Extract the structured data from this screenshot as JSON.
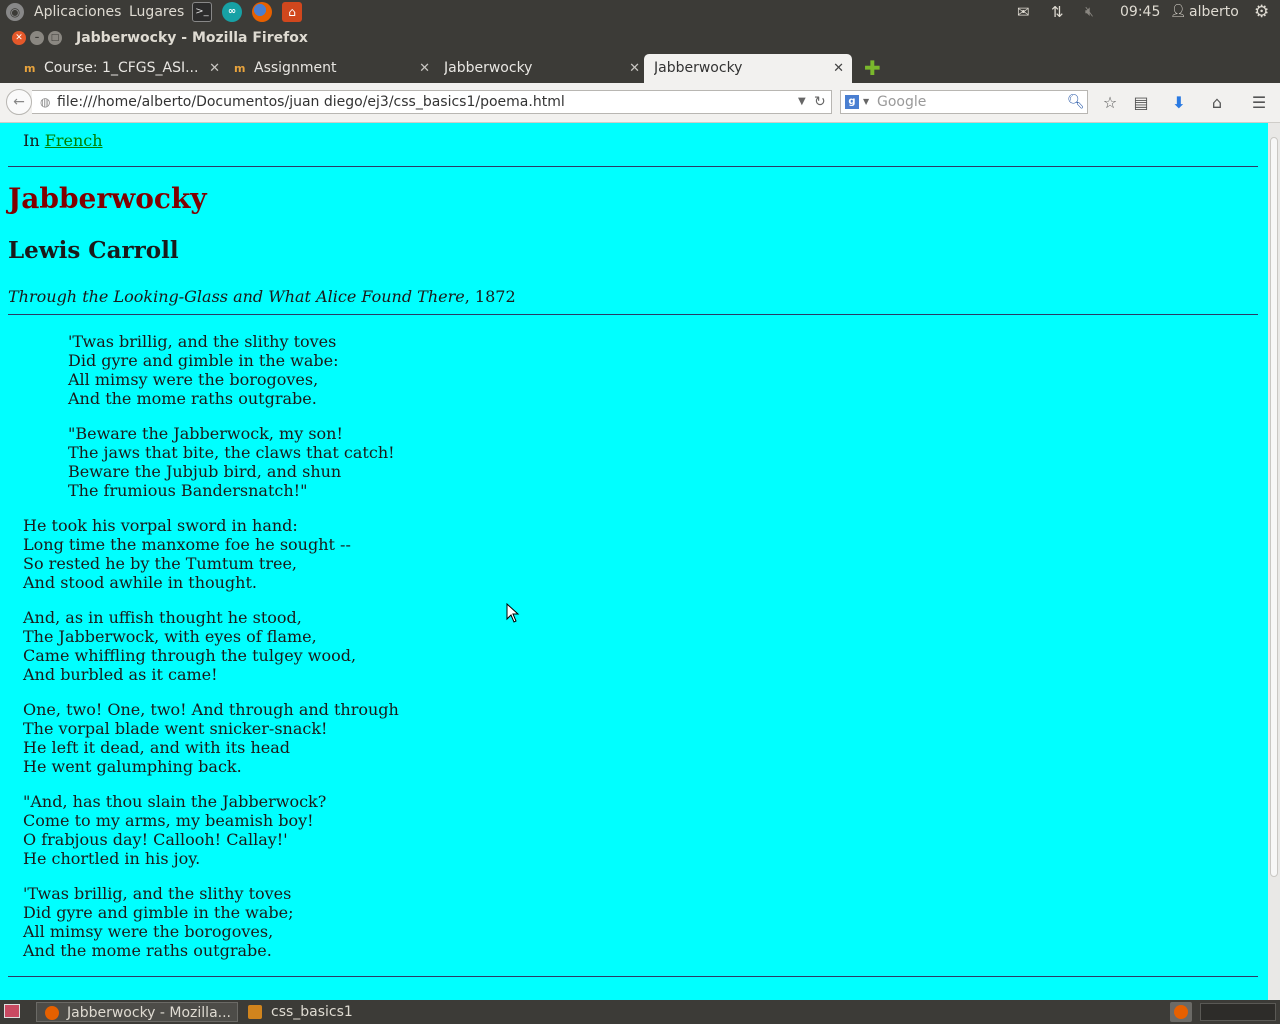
{
  "panel": {
    "applications": "Aplicaciones",
    "places": "Lugares",
    "time": "09:45",
    "user": "alberto"
  },
  "window": {
    "title": "Jabberwocky - Mozilla Firefox"
  },
  "tabs": [
    {
      "label": "Course: 1_CFGS_ASI..."
    },
    {
      "label": "Assignment"
    },
    {
      "label": "Jabberwocky"
    },
    {
      "label": "Jabberwocky"
    }
  ],
  "nav": {
    "url": "file:///home/alberto/Documentos/juan diego/ej3/css_basics1/poema.html",
    "search_placeholder": "Google"
  },
  "page": {
    "in_prefix": "In",
    "french_link": "French",
    "title": "Jabberwocky",
    "author": "Lewis Carroll",
    "source_italic": "Through the Looking-Glass and What Alice Found There",
    "source_year": ", 1872",
    "stanzas": [
      [
        "'Twas brillig, and the slithy toves",
        "Did gyre and gimble in the wabe:",
        "All mimsy were the borogoves,",
        "And the mome raths outgrabe."
      ],
      [
        "\"Beware the Jabberwock, my son!",
        "The jaws that bite, the claws that catch!",
        "Beware the Jubjub bird, and shun",
        "The frumious Bandersnatch!\""
      ],
      [
        "He took his vorpal sword in hand:",
        "Long time the manxome foe he sought --",
        "So rested he by the Tumtum tree,",
        "And stood awhile in thought."
      ],
      [
        "And, as in uffish thought he stood,",
        "The Jabberwock, with eyes of flame,",
        "Came whiffling through the tulgey wood,",
        "And burbled as it came!"
      ],
      [
        "One, two! One, two! And through and through",
        "The vorpal blade went snicker-snack!",
        "He left it dead, and with its head",
        "He went galumphing back."
      ],
      [
        "\"And, has thou slain the Jabberwock?",
        "Come to my arms, my beamish boy!",
        "O frabjous day! Callooh! Callay!'",
        "He chortled in his joy."
      ],
      [
        "'Twas brillig, and the slithy toves",
        "Did gyre and gimble in the wabe;",
        "All mimsy were the borogoves,",
        "And the mome raths outgrabe."
      ]
    ]
  },
  "taskbar": {
    "tasks": [
      {
        "label": "Jabberwocky - Mozilla..."
      },
      {
        "label": "css_basics1"
      }
    ]
  },
  "colors": {
    "page_background": "#00ffff",
    "title_color": "#800000",
    "link_color": "#008000",
    "panel_background": "#3c3b37"
  },
  "icons": [
    "ubuntu-logo-icon",
    "terminal-icon",
    "arduino-icon",
    "firefox-icon",
    "home-folder-icon",
    "mail-icon",
    "network-icon",
    "volume-muted-icon",
    "user-icon",
    "settings-gear-icon",
    "back-arrow-icon",
    "reload-icon",
    "google-icon",
    "search-icon",
    "bookmark-star-icon",
    "reading-list-icon",
    "downloads-icon",
    "home-icon",
    "menu-icon"
  ]
}
